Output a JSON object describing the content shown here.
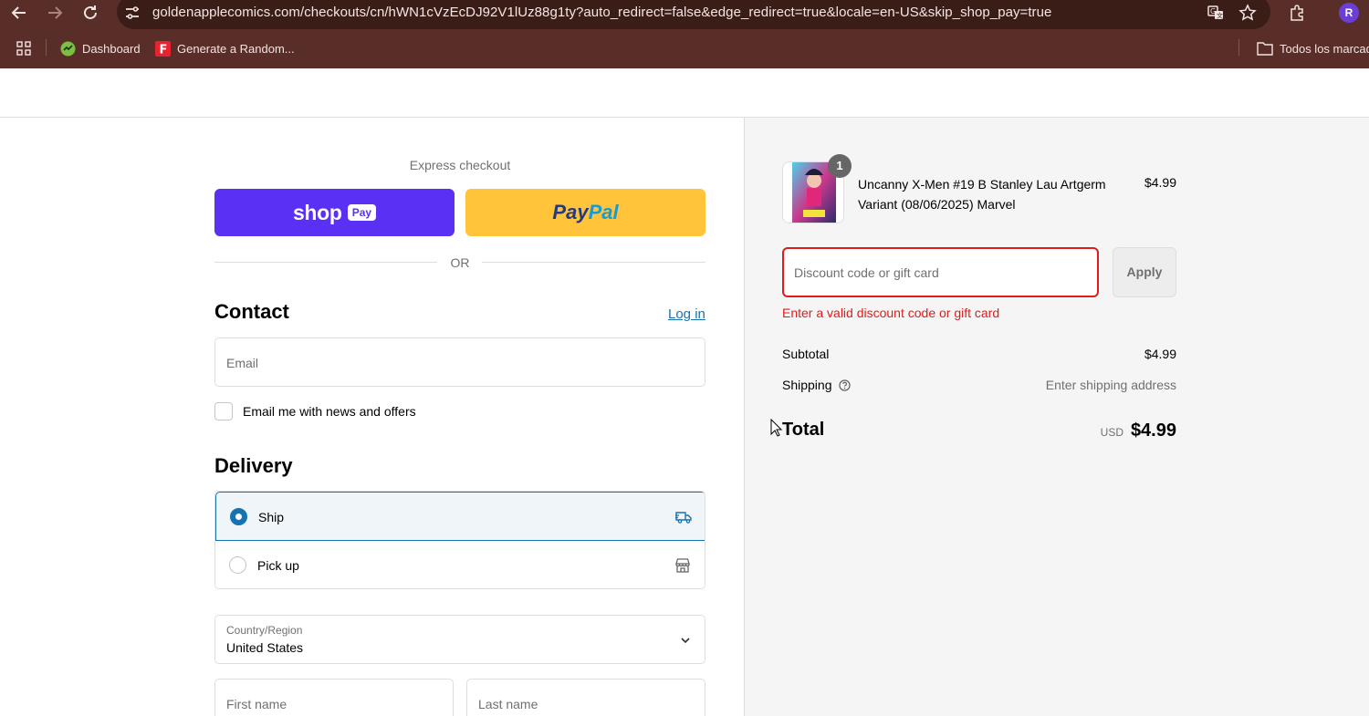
{
  "browser": {
    "url": "goldenapplecomics.com/checkouts/cn/hWN1cVzEcDJ92V1lUz88g1ty?auto_redirect=false&edge_redirect=true&locale=en-US&skip_shop_pay=true",
    "profile_initial": "R",
    "bookmarks": [
      {
        "label": "Dashboard",
        "icon": "dashboard-favicon"
      },
      {
        "label": "Generate a Random...",
        "icon": "f-favicon"
      }
    ],
    "all_bookmarks_label": "Todos los marcad"
  },
  "express": {
    "label": "Express checkout",
    "shop_word": "shop",
    "shop_pill": "Pay",
    "paypal_part1": "Pay",
    "paypal_part2": "Pal",
    "or_text": "OR"
  },
  "contact": {
    "title": "Contact",
    "login_label": "Log in",
    "email_placeholder": "Email",
    "newsletter_label": "Email me with news and offers"
  },
  "delivery": {
    "title": "Delivery",
    "options": [
      {
        "label": "Ship",
        "selected": true,
        "icon": "truck-icon"
      },
      {
        "label": "Pick up",
        "selected": false,
        "icon": "store-icon"
      }
    ],
    "country_label": "Country/Region",
    "country_value": "United States",
    "first_name_placeholder": "First name",
    "last_name_placeholder": "Last name"
  },
  "order": {
    "item": {
      "name": "Uncanny X-Men #19 B Stanley Lau Artgerm Variant (08/06/2025) Marvel",
      "quantity": "1",
      "price": "$4.99"
    },
    "discount_placeholder": "Discount code or gift card",
    "apply_label": "Apply",
    "discount_error": "Enter a valid discount code or gift card",
    "subtotal_label": "Subtotal",
    "subtotal_value": "$4.99",
    "shipping_label": "Shipping",
    "shipping_value": "Enter shipping address",
    "total_label": "Total",
    "total_currency": "USD",
    "total_value": "$4.99"
  },
  "colors": {
    "chrome": "#5a2e28",
    "shop_pay": "#5a31f4",
    "paypal": "#ffc439",
    "link": "#1773b0",
    "error": "#dd1d1d"
  }
}
